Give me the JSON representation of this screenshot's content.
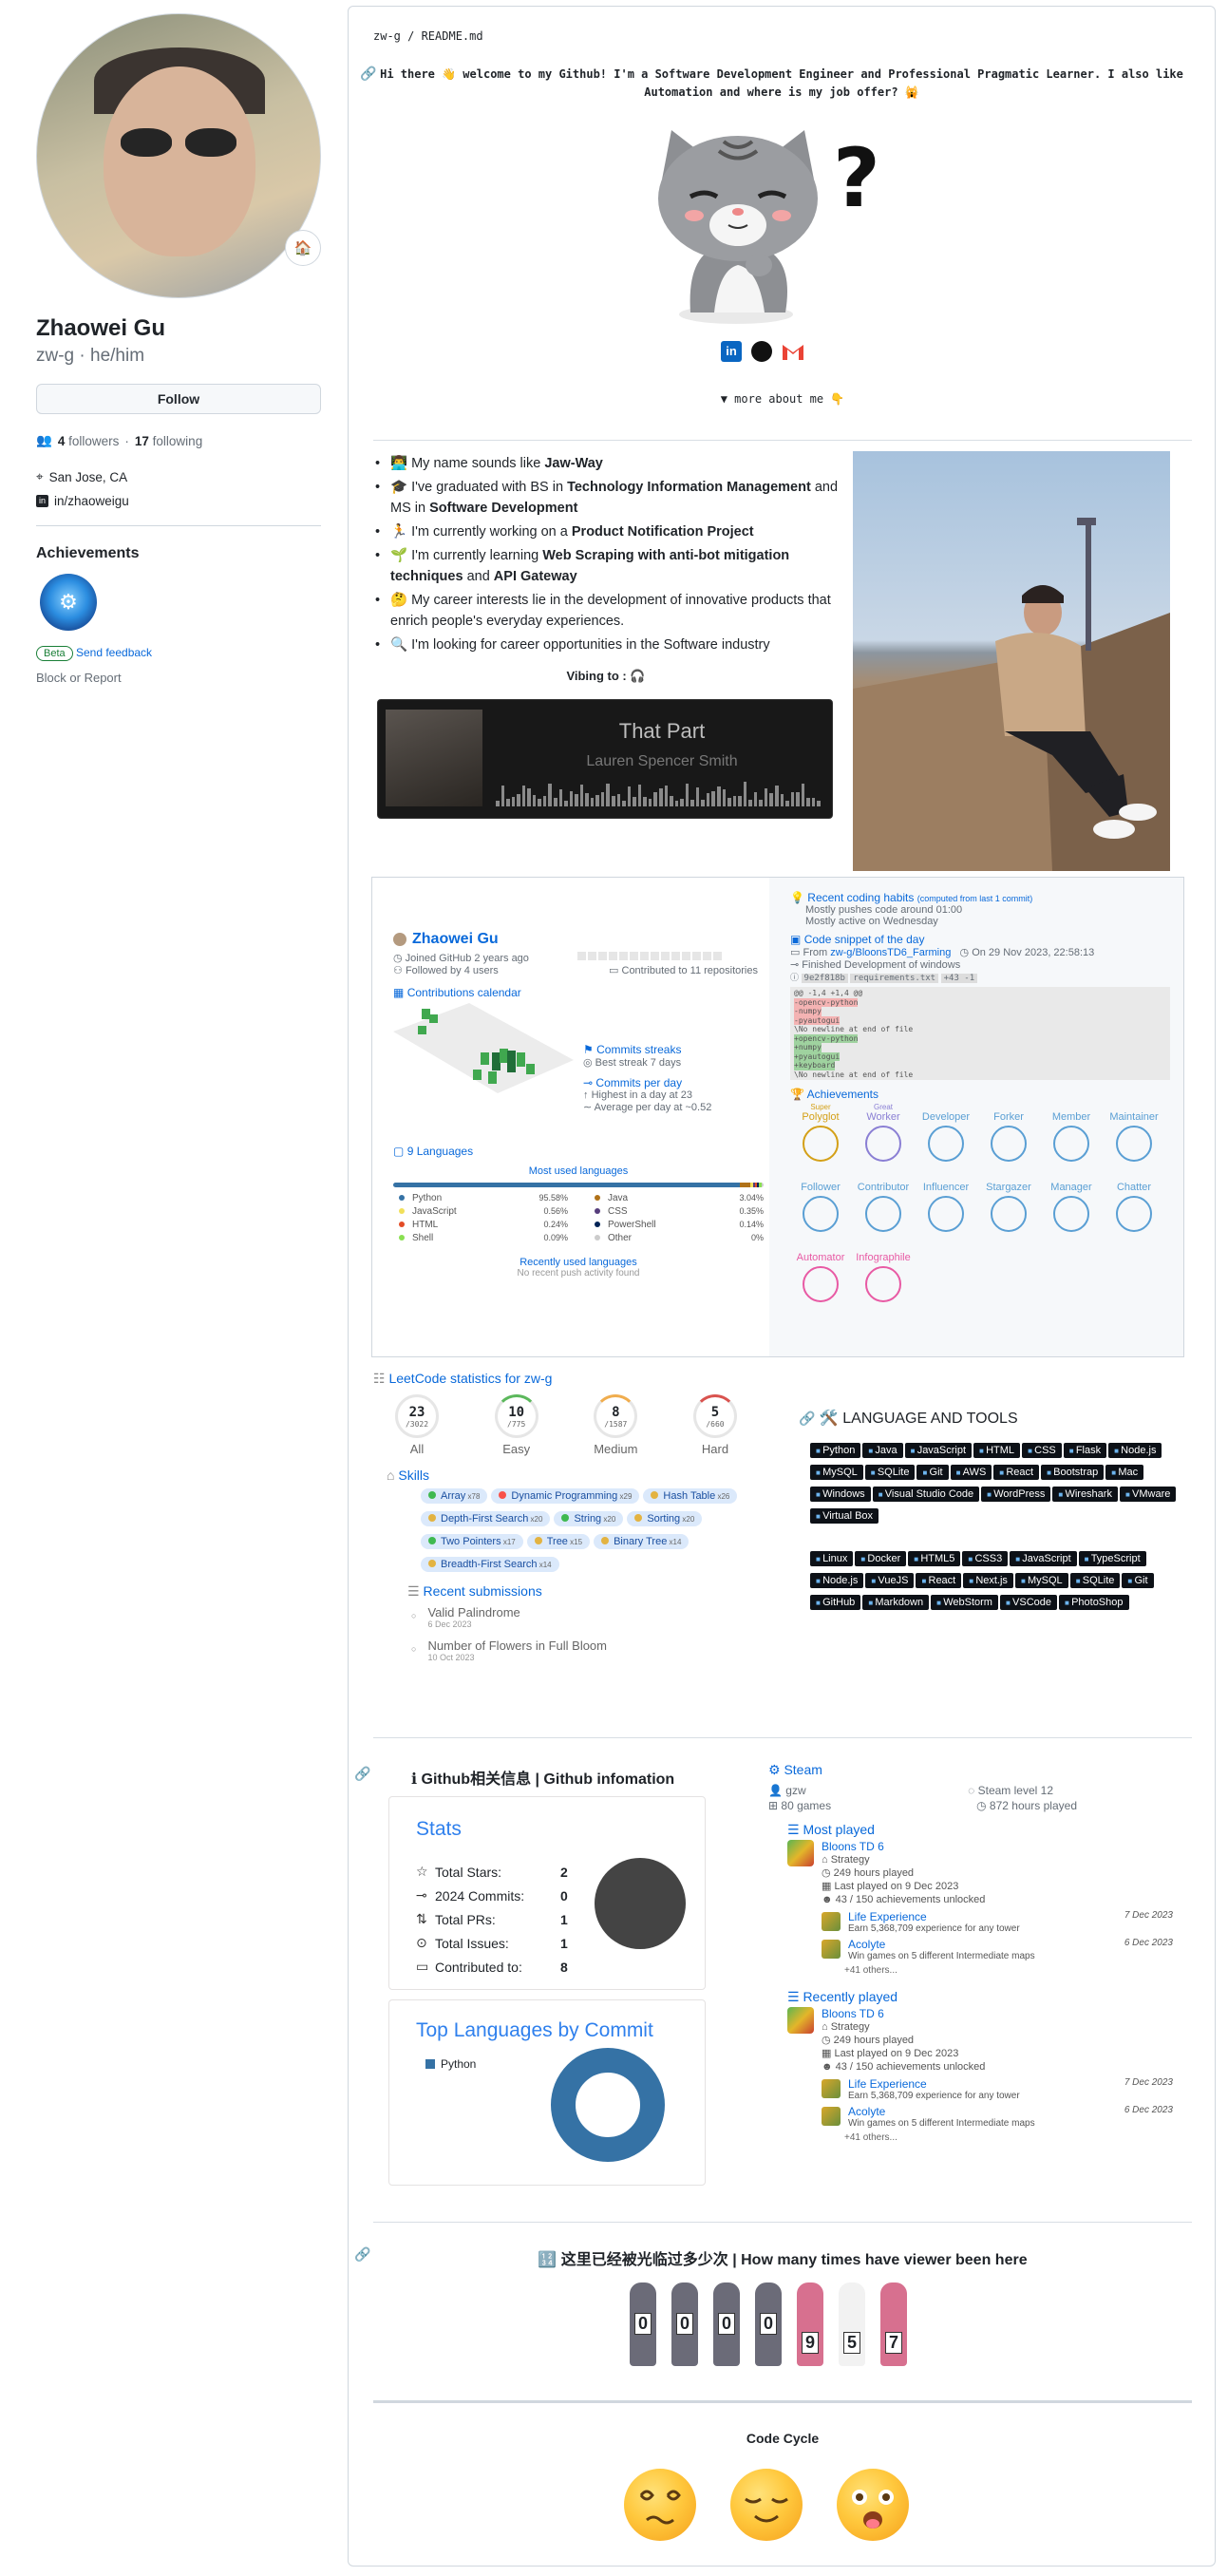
{
  "sidebar": {
    "name": "Zhaowei Gu",
    "login": "zw-g",
    "pronouns": "he/him",
    "follow_label": "Follow",
    "followers_count": "4",
    "followers_label": "followers",
    "following_count": "17",
    "following_label": "following",
    "location": "San Jose, CA",
    "linkedin": "in/zhaoweigu",
    "achievements_title": "Achievements",
    "beta_label": "Beta",
    "feedback_label": "Send feedback",
    "block_label": "Block or Report"
  },
  "readme": {
    "path": "zw-g / README.md",
    "intro": "Hi there 👋 welcome to my Github! I'm a Software Development Engineer and Professional Pragmatic Learner. I also like Automation and where is my job offer? 🙀",
    "more_about": "▼ more about me 👇",
    "about": [
      {
        "icon": "👨‍💻",
        "pre": "My name sounds like ",
        "bold": "Jaw-Way",
        "post": ""
      },
      {
        "icon": "🎓",
        "pre": "I've graduated with BS in ",
        "bold": "Technology Information Management",
        "post": " and MS in ",
        "bold2": "Software Development"
      },
      {
        "icon": "🏃",
        "pre": "I'm currently working on a ",
        "bold": "Product Notification Project",
        "post": ""
      },
      {
        "icon": "🌱",
        "pre": "I'm currently learning ",
        "bold": "Web Scraping with anti-bot mitigation techniques",
        "post": " and ",
        "bold2": "API Gateway"
      },
      {
        "icon": "🤔",
        "pre": "My career interests lie in the development of innovative products that enrich people's everyday experiences.",
        "bold": "",
        "post": ""
      },
      {
        "icon": "🔍",
        "pre": "I'm looking for career opportunities in the Software industry",
        "bold": "",
        "post": ""
      }
    ],
    "vibing": "Vibing to : 🎧",
    "song_title": "That Part",
    "song_artist": "Lauren Spencer Smith"
  },
  "metrics": {
    "name": "Zhaowei Gu",
    "joined": "Joined GitHub 2 years ago",
    "followed": "Followed by 4 users",
    "contributed": "Contributed to 11 repositories",
    "calendar": "Contributions calendar",
    "commit_streaks": "Commits streaks",
    "best_streak": "Best streak 7 days",
    "commits_per_day": "Commits per day",
    "highest": "Highest in a day at 23",
    "average": "Average per day at ~0.52",
    "languages_title": "9 Languages",
    "most_used": "Most used languages",
    "recently_used": "Recently used languages",
    "no_recent": "No recent push activity found",
    "languages": [
      {
        "name": "Python",
        "pct": "95.58%",
        "color": "#3572A5"
      },
      {
        "name": "Java",
        "pct": "3.04%",
        "color": "#b07219"
      },
      {
        "name": "JavaScript",
        "pct": "0.56%",
        "color": "#f1e05a"
      },
      {
        "name": "CSS",
        "pct": "0.35%",
        "color": "#563d7c"
      },
      {
        "name": "HTML",
        "pct": "0.24%",
        "color": "#e34c26"
      },
      {
        "name": "PowerShell",
        "pct": "0.14%",
        "color": "#012456"
      },
      {
        "name": "Shell",
        "pct": "0.09%",
        "color": "#89e051"
      },
      {
        "name": "Other",
        "pct": "0%",
        "color": "#cccccc"
      }
    ],
    "coding_habits": "Recent coding habits",
    "coding_note": "(computed from last 1 commit)",
    "pushes": "Mostly pushes code around 01:00",
    "active": "Mostly active on Wednesday",
    "snippet_title": "Code snippet of the day",
    "snippet_from_label": "From",
    "snippet_from": "zw-g/BloonsTD6_Farming",
    "snippet_date": "On 29 Nov 2023, 22:58:13",
    "snippet_desc": "Finished Development of windows",
    "snippet_hash": "9e2f818b",
    "snippet_file": "requirements.txt",
    "snippet_diff": "+43 -1",
    "code_lines": [
      "@@ -1,4 +1,4 @@",
      "-opencv-python",
      "-numpy",
      "-pyautogui",
      "\\No newline at end of file",
      "+opencv-python",
      "+numpy",
      "+pyautogui",
      "+keyboard",
      "\\No newline at end of file"
    ],
    "achievements_title": "Achievements",
    "achievements": [
      {
        "top": "Super",
        "name": "Polyglot",
        "color": "#d4a017"
      },
      {
        "top": "Great",
        "name": "Worker",
        "color": "#8a7fd4"
      },
      {
        "top": "",
        "name": "Developer",
        "color": "#5a9fd4"
      },
      {
        "top": "",
        "name": "Forker",
        "color": "#5a9fd4"
      },
      {
        "top": "",
        "name": "Member",
        "color": "#5a9fd4"
      },
      {
        "top": "",
        "name": "Maintainer",
        "color": "#5a9fd4"
      },
      {
        "top": "",
        "name": "Follower",
        "color": "#5a9fd4"
      },
      {
        "top": "",
        "name": "Contributor",
        "color": "#5a9fd4"
      },
      {
        "top": "",
        "name": "Influencer",
        "color": "#5a9fd4"
      },
      {
        "top": "",
        "name": "Stargazer",
        "color": "#5a9fd4"
      },
      {
        "top": "",
        "name": "Manager",
        "color": "#5a9fd4"
      },
      {
        "top": "",
        "name": "Chatter",
        "color": "#5a9fd4"
      },
      {
        "top": "",
        "name": "Automator",
        "color": "#e85aa4"
      },
      {
        "top": "",
        "name": "Infographile",
        "color": "#e85aa4"
      }
    ]
  },
  "leetcode": {
    "title": "LeetCode statistics for zw-g",
    "counts": [
      {
        "value": "23",
        "total": "/3022",
        "label": "All",
        "color": "#e6e6e6"
      },
      {
        "value": "10",
        "total": "/775",
        "label": "Easy",
        "color": "#5cb85c"
      },
      {
        "value": "8",
        "total": "/1587",
        "label": "Medium",
        "color": "#f0ad4e"
      },
      {
        "value": "5",
        "total": "/660",
        "label": "Hard",
        "color": "#d9534f"
      }
    ],
    "skills_title": "Skills",
    "skills": [
      {
        "name": "Array",
        "count": "x78",
        "color": "#3fb950"
      },
      {
        "name": "Dynamic Programming",
        "count": "x29",
        "color": "#f85149"
      },
      {
        "name": "Hash Table",
        "count": "x26",
        "color": "#e3b341"
      },
      {
        "name": "Depth-First Search",
        "count": "x20",
        "color": "#e3b341"
      },
      {
        "name": "String",
        "count": "x20",
        "color": "#3fb950"
      },
      {
        "name": "Sorting",
        "count": "x20",
        "color": "#e3b341"
      },
      {
        "name": "Two Pointers",
        "count": "x17",
        "color": "#3fb950"
      },
      {
        "name": "Tree",
        "count": "x15",
        "color": "#e3b341"
      },
      {
        "name": "Binary Tree",
        "count": "x14",
        "color": "#e3b341"
      },
      {
        "name": "Breadth-First Search",
        "count": "x14",
        "color": "#e3b341"
      }
    ],
    "recent_title": "Recent submissions",
    "recent": [
      {
        "name": "Valid Palindrome",
        "date": "6 Dec 2023"
      },
      {
        "name": "Number of Flowers in Full Bloom",
        "date": "10 Oct 2023"
      }
    ]
  },
  "tools": {
    "title": "🛠️ LANGUAGE AND TOOLS",
    "group1": [
      "Python",
      "Java",
      "JavaScript",
      "HTML",
      "CSS",
      "Flask",
      "Node.js",
      "MySQL",
      "SQLite",
      "Git",
      "AWS",
      "React",
      "Bootstrap",
      "Mac",
      "Windows",
      "Visual Studio Code",
      "WordPress",
      "Wireshark",
      "VMware",
      "Virtual Box"
    ],
    "group2": [
      "Linux",
      "Docker",
      "HTML5",
      "CSS3",
      "JavaScript",
      "TypeScript",
      "Node.js",
      "VueJS",
      "React",
      "Next.js",
      "MySQL",
      "SQLite",
      "Git",
      "GitHub",
      "Markdown",
      "WebStorm",
      "VSCode",
      "PhotoShop"
    ]
  },
  "github_info": {
    "title": "ℹ Github相关信息 | Github infomation",
    "stats_title": "Stats",
    "stats": [
      {
        "icon": "☆",
        "label": "Total Stars:",
        "value": "2"
      },
      {
        "icon": "⊸",
        "label": "2024 Commits:",
        "value": "0"
      },
      {
        "icon": "⇅",
        "label": "Total PRs:",
        "value": "1"
      },
      {
        "icon": "⊙",
        "label": "Total Issues:",
        "value": "1"
      },
      {
        "icon": "▭",
        "label": "Contributed to:",
        "value": "8"
      }
    ],
    "top_lang_title": "Top Languages by Commit",
    "top_lang_legend": "Python",
    "top_lang_color": "#3572A5"
  },
  "steam": {
    "title": "Steam",
    "user": "gzw",
    "level": "Steam level 12",
    "games": "80 games",
    "hours": "872 hours played",
    "sections": [
      {
        "title": "Most played",
        "game": "Bloons TD 6",
        "genre": "Strategy",
        "hours": "249 hours played",
        "last": "Last played on 9 Dec 2023",
        "ach": "43 / 150 achievements unlocked",
        "items": [
          {
            "name": "Life Experience",
            "desc": "Earn 5,368,709 experience for any tower",
            "date": "7 Dec 2023"
          },
          {
            "name": "Acolyte",
            "desc": "Win games on 5 different Intermediate maps",
            "date": "6 Dec 2023"
          }
        ],
        "others": "+41 others..."
      },
      {
        "title": "Recently played",
        "game": "Bloons TD 6",
        "genre": "Strategy",
        "hours": "249 hours played",
        "last": "Last played on 9 Dec 2023",
        "ach": "43 / 150 achievements unlocked",
        "items": [
          {
            "name": "Life Experience",
            "desc": "Earn 5,368,709 experience for any tower",
            "date": "7 Dec 2023"
          },
          {
            "name": "Acolyte",
            "desc": "Win games on 5 different Intermediate maps",
            "date": "6 Dec 2023"
          }
        ],
        "others": "+41 others..."
      }
    ]
  },
  "visitors": {
    "title": "🔢 这里已经被光临过多少次 | How many times have viewer been here",
    "digits": [
      "0",
      "0",
      "0",
      "0",
      "9",
      "5",
      "7"
    ]
  },
  "code_cycle": {
    "title": "Code Cycle"
  }
}
